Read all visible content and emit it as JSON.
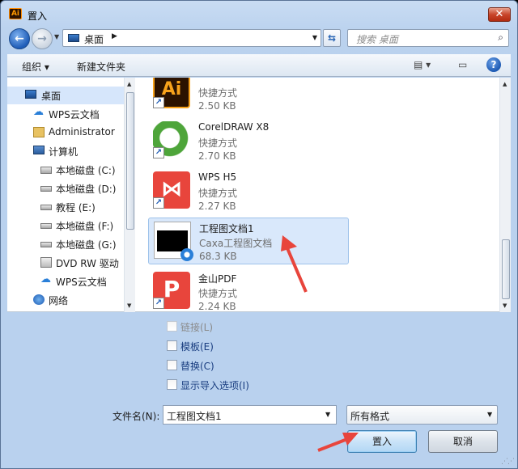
{
  "window": {
    "title": "置入",
    "app_icon": "Ai",
    "close_label": "✕"
  },
  "nav": {
    "back_icon": "←",
    "forward_icon": "→",
    "address_path": "桌面",
    "address_sep": "▶",
    "search_placeholder": "搜索 桌面",
    "search_icon": "🔍"
  },
  "toolbar": {
    "organize": "组织 ▾",
    "new_folder": "新建文件夹",
    "help": "?"
  },
  "sidebar": {
    "items": [
      {
        "label": "桌面",
        "icon": "desktop-icon"
      },
      {
        "label": "WPS云文档",
        "icon": "cloud-icon"
      },
      {
        "label": "Administrator",
        "icon": "user-folder-icon"
      },
      {
        "label": "计算机",
        "icon": "computer-icon"
      },
      {
        "label": "本地磁盘 (C:)",
        "icon": "system-drive-icon"
      },
      {
        "label": "本地磁盘 (D:)",
        "icon": "drive-icon"
      },
      {
        "label": "教程 (E:)",
        "icon": "drive-icon"
      },
      {
        "label": "本地磁盘 (F:)",
        "icon": "drive-icon"
      },
      {
        "label": "本地磁盘 (G:)",
        "icon": "drive-icon"
      },
      {
        "label": "DVD RW 驱动",
        "icon": "dvd-icon"
      },
      {
        "label": "WPS云文档",
        "icon": "cloud-icon"
      },
      {
        "label": "网络",
        "icon": "network-icon"
      }
    ]
  },
  "files": [
    {
      "name": "Ai",
      "type": "快捷方式",
      "size": "2.50 KB",
      "icon": "illustrator-icon"
    },
    {
      "name": "CorelDRAW X8",
      "type": "快捷方式",
      "size": "2.70 KB",
      "icon": "coreldraw-icon"
    },
    {
      "name": "WPS H5",
      "type": "快捷方式",
      "size": "2.27 KB",
      "icon": "wps-h5-icon"
    },
    {
      "name": "工程图文档1",
      "type": "Caxa工程图文档",
      "size": "68.3 KB",
      "icon": "caxa-document-icon"
    },
    {
      "name": "金山PDF",
      "type": "快捷方式",
      "size": "2.24 KB",
      "icon": "kingsoft-pdf-icon"
    }
  ],
  "options": [
    {
      "label": "链接(L)",
      "enabled": false
    },
    {
      "label": "模板(E)",
      "enabled": true
    },
    {
      "label": "替换(C)",
      "enabled": true
    },
    {
      "label": "显示导入选项(I)",
      "enabled": true
    }
  ],
  "filename": {
    "label": "文件名(N):",
    "value": "工程图文档1"
  },
  "format": {
    "value": "所有格式"
  },
  "buttons": {
    "place": "置入",
    "cancel": "取消"
  },
  "colors": {
    "selection": "#d9e8fb",
    "arrow": "#e8453c",
    "ai_orange": "#f7a21b",
    "corel_green": "#4ea53a",
    "wps_red": "#e8453c"
  }
}
